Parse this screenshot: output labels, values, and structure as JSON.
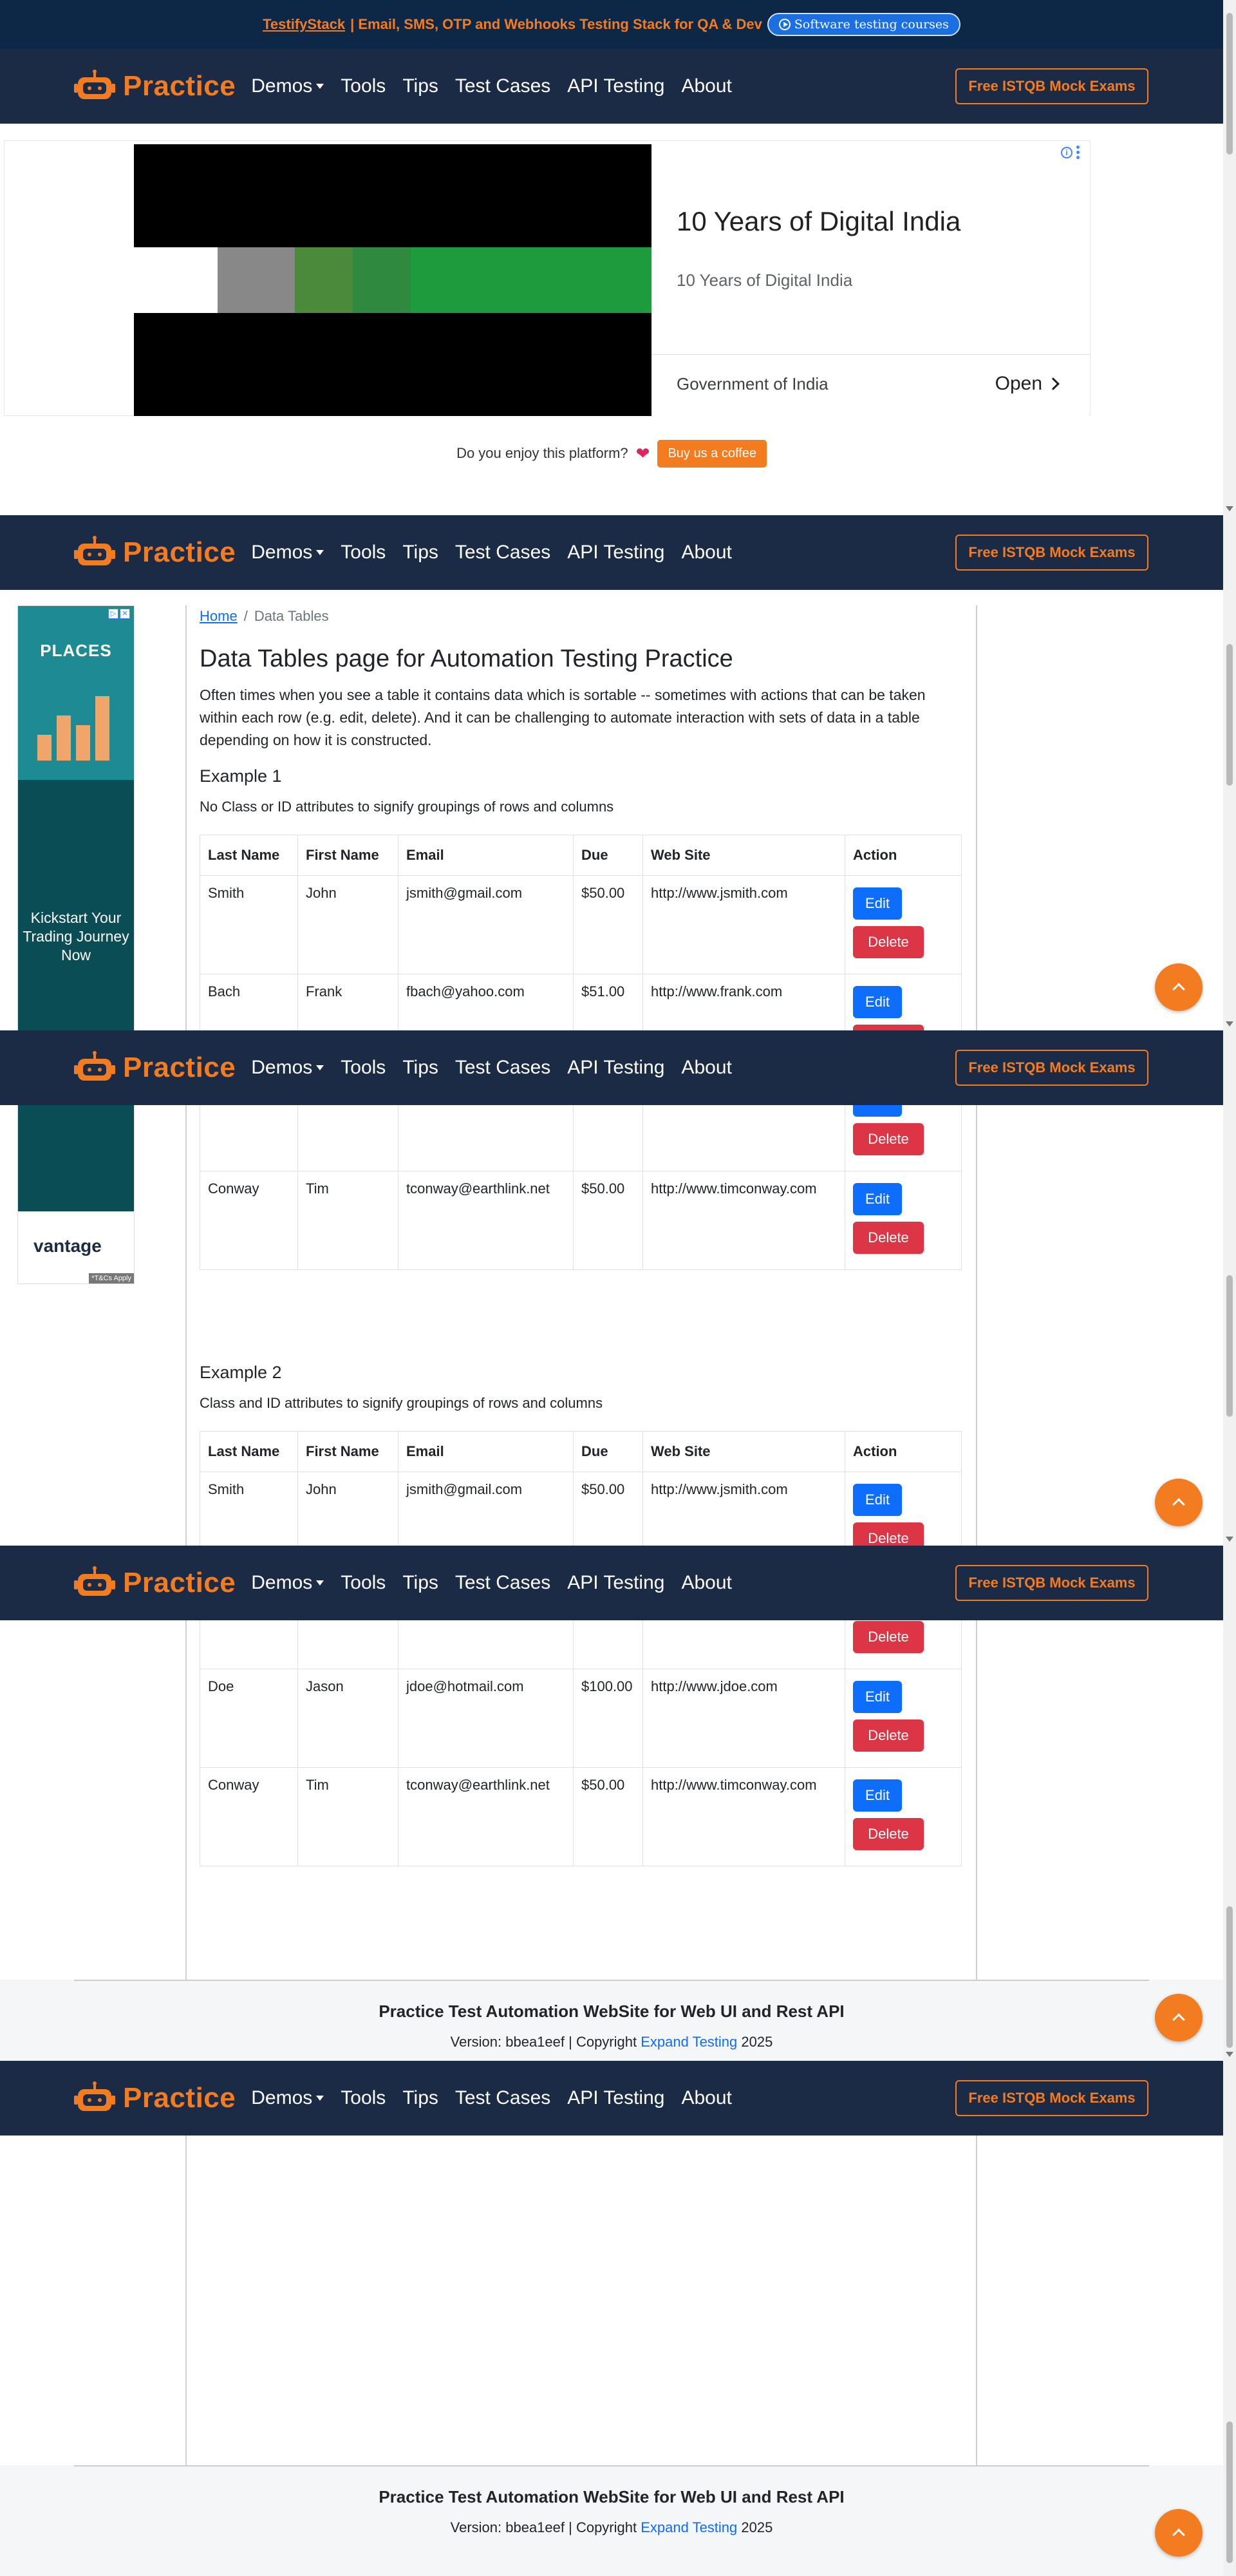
{
  "promo": {
    "brand": "TestifyStack",
    "text": "| Email, SMS, OTP and Webhooks Testing Stack for QA & Dev",
    "pill": "Software testing courses"
  },
  "nav": {
    "logo": "Practice",
    "items": [
      "Demos",
      "Tools",
      "Tips",
      "Test Cases",
      "API Testing",
      "About"
    ],
    "cta": "Free ISTQB Mock Exams"
  },
  "ad": {
    "headline": "10 Years of Digital India",
    "subline": "10 Years of Digital India",
    "advertiser": "Government of India",
    "open": "Open"
  },
  "coffee": {
    "question": "Do you enjoy this platform?",
    "button": "Buy us a coffee"
  },
  "side_ad": {
    "headline": "PLACES",
    "text": "Kickstart Your Trading Journey Now",
    "brand": "vantage",
    "tc": "*T&Cs Apply"
  },
  "breadcrumb": {
    "home": "Home",
    "separator": "/",
    "current": "Data Tables"
  },
  "page": {
    "title": "Data Tables page for Automation Testing Practice",
    "intro": "Often times when you see a table it contains data which is sortable -- sometimes with actions that can be taken within each row (e.g. edit, delete). And it can be challenging to automate interaction with sets of data in a table depending on how it is constructed."
  },
  "example1": {
    "title": "Example 1",
    "desc": "No Class or ID attributes to signify groupings of rows and columns"
  },
  "example2": {
    "title": "Example 2",
    "desc": "Class and ID attributes to signify groupings of rows and columns"
  },
  "table": {
    "headers": [
      "Last Name",
      "First Name",
      "Email",
      "Due",
      "Web Site",
      "Action"
    ],
    "rows": [
      [
        "Smith",
        "John",
        "jsmith@gmail.com",
        "$50.00",
        "http://www.jsmith.com"
      ],
      [
        "Bach",
        "Frank",
        "fbach@yahoo.com",
        "$51.00",
        "http://www.frank.com"
      ],
      [
        "Doe",
        "Jason",
        "jdoe@hotmail.com",
        "$100.00",
        "http://www.jdoe.com"
      ],
      [
        "Conway",
        "Tim",
        "tconway@earthlink.net",
        "$50.00",
        "http://www.timconway.com"
      ]
    ],
    "edit": "Edit",
    "delete": "Delete"
  },
  "footer": {
    "title": "Practice Test Automation WebSite for Web UI and Rest API",
    "version_prefix": "Version: bbea1eef | Copyright",
    "company": "Expand Testing",
    "year": "2025"
  },
  "colors": {
    "navy": "#1b2b45",
    "orange": "#f47c20",
    "primary": "#0d6efd",
    "danger": "#dc3545"
  }
}
